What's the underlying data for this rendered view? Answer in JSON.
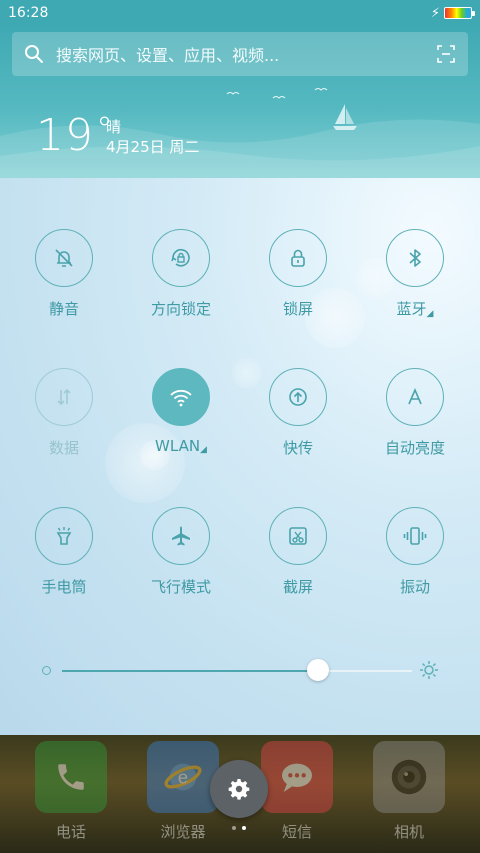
{
  "status_bar": {
    "time": "16:28"
  },
  "search": {
    "placeholder": "搜索网页、设置、应用、视频..."
  },
  "weather": {
    "temperature": "19",
    "degree": "°",
    "condition": "晴",
    "date": "4月25日 周二"
  },
  "toggles": [
    {
      "label": "静音",
      "icon": "bell-off-icon",
      "state": "off"
    },
    {
      "label": "方向锁定",
      "icon": "rotation-lock-icon",
      "state": "off"
    },
    {
      "label": "锁屏",
      "icon": "lock-icon",
      "state": "off"
    },
    {
      "label": "蓝牙",
      "icon": "bluetooth-icon",
      "state": "off",
      "has_more": true
    },
    {
      "label": "数据",
      "icon": "data-arrows-icon",
      "state": "disabled"
    },
    {
      "label": "WLAN",
      "icon": "wifi-icon",
      "state": "on",
      "has_more": true
    },
    {
      "label": "快传",
      "icon": "quick-send-icon",
      "state": "off"
    },
    {
      "label": "自动亮度",
      "icon": "auto-brightness-icon",
      "state": "off"
    },
    {
      "label": "手电筒",
      "icon": "flashlight-icon",
      "state": "off"
    },
    {
      "label": "飞行模式",
      "icon": "airplane-icon",
      "state": "off"
    },
    {
      "label": "截屏",
      "icon": "screenshot-icon",
      "state": "off"
    },
    {
      "label": "振动",
      "icon": "vibrate-icon",
      "state": "off"
    }
  ],
  "brightness": {
    "value": 0.73
  },
  "dock": {
    "apps": [
      {
        "label": "电话",
        "icon": "phone-icon",
        "color": "#2f9a3a"
      },
      {
        "label": "浏览器",
        "icon": "browser-icon",
        "color": "#3a7fd6"
      },
      {
        "label": "短信",
        "icon": "message-icon",
        "color": "#e2434a"
      },
      {
        "label": "相机",
        "icon": "camera-icon",
        "color": "#8c8c8c"
      }
    ]
  },
  "pager": {
    "pages": 2,
    "current": 2
  },
  "colors": {
    "accent": "#4aa3ab",
    "header": "#3fa9b3",
    "active_toggle": "#5db8bf"
  }
}
